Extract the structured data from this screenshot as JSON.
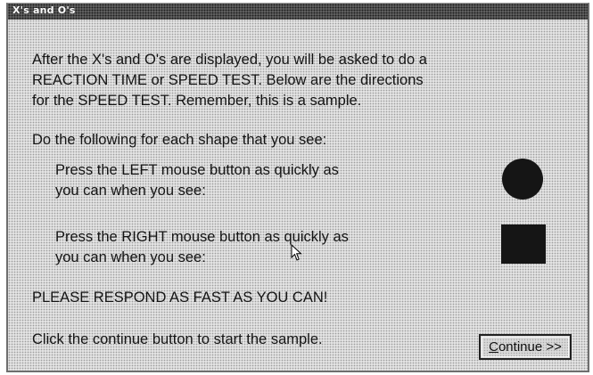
{
  "window": {
    "title": "X's and O's"
  },
  "intro": {
    "line1": "After the X's and O's are displayed, you will be asked to do a",
    "line2": "REACTION TIME or SPEED TEST.  Below are the directions",
    "line3": "for the SPEED TEST.  Remember, this is a sample."
  },
  "instruction_heading": "Do the following for each shape that you see:",
  "left_instruction": {
    "line1": "Press the LEFT mouse button as quickly as",
    "line2": "you can when you see:"
  },
  "right_instruction": {
    "line1": "Press the RIGHT mouse button as quickly as",
    "line2": "you can when you see:"
  },
  "shapes": {
    "left": "circle-icon",
    "right": "square-icon",
    "color": "#151515"
  },
  "emphasis": "PLEASE RESPOND AS FAST AS YOU CAN!",
  "footer": {
    "prompt": "Click the continue button to start the sample.",
    "continue_underlined": "C",
    "continue_rest": "ontinue >>"
  }
}
